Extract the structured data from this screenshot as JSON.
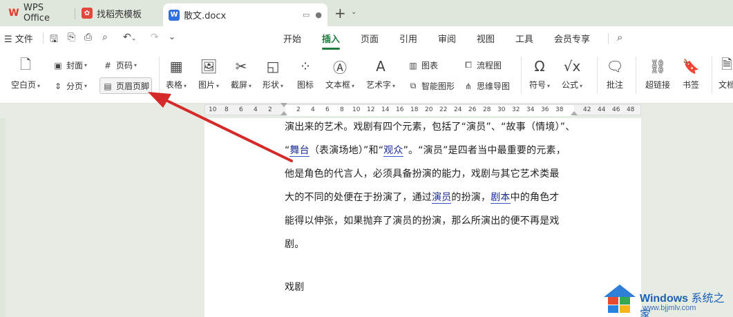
{
  "tabs": {
    "wps": "WPS Office",
    "template": "找稻壳模板",
    "document": "散文.docx"
  },
  "menubar": {
    "file": "文件",
    "tabs": [
      "开始",
      "插入",
      "页面",
      "引用",
      "审阅",
      "视图",
      "工具",
      "会员专享"
    ],
    "active_tab": "插入"
  },
  "ribbon": {
    "blank_page": "空白页",
    "cover": "封面",
    "page_break": "分页",
    "page_number": "页码",
    "header_footer": "页眉页脚",
    "table": "表格",
    "picture": "图片",
    "screenshot": "截屏",
    "shape": "形状",
    "icon": "图标",
    "textbox": "文本框",
    "wordart": "艺术字",
    "chart": "图表",
    "smart_graphic": "智能图形",
    "flowchart": "流程图",
    "mindmap": "思维导图",
    "symbol": "符号",
    "formula": "公式",
    "comment": "批注",
    "hyperlink": "超链接",
    "bookmark": "书签",
    "more": "文档"
  },
  "ruler": {
    "left_numbers": [
      "10",
      "8",
      "6",
      "4",
      "2"
    ],
    "right_numbers": [
      "2",
      "4",
      "6",
      "8",
      "10",
      "12",
      "14",
      "16",
      "18",
      "20",
      "22",
      "24",
      "26",
      "28",
      "30",
      "32",
      "34",
      "36",
      "38"
    ],
    "far_numbers": [
      "42",
      "44",
      "46",
      "48"
    ]
  },
  "document": {
    "line1": "演出来的艺术。戏剧有四个元素，包括了“演员”、“故事（情境）”、",
    "line2_pre": "“",
    "line2_w1": "舞台",
    "line2_mid": "（表演场地）”和“",
    "line2_w2": "观众",
    "line2_post": "”。“演员”是四者当中最重要的元素，",
    "line3": "他是角色的代言人，必须具备扮演的能力，戏剧与其它艺术类最",
    "line4_pre": "大的不同的处便在于扮演了，通过",
    "line4_w1": "演员",
    "line4_mid": "的扮演，",
    "line4_w2": "剧本",
    "line4_post": "中的角色才",
    "line5": "能得以伸张，如果抛弃了演员的扮演，那么所演出的便不再是戏",
    "line6": "剧。",
    "heading": "戏剧"
  },
  "watermark": {
    "brand": "Windows",
    "brand_cn": "系统之家",
    "url": "www.bjjmlv.com"
  },
  "colors": {
    "accent": "#1f7a3f",
    "arrow": "#d42a2a",
    "link_underline": "#3454c8"
  }
}
